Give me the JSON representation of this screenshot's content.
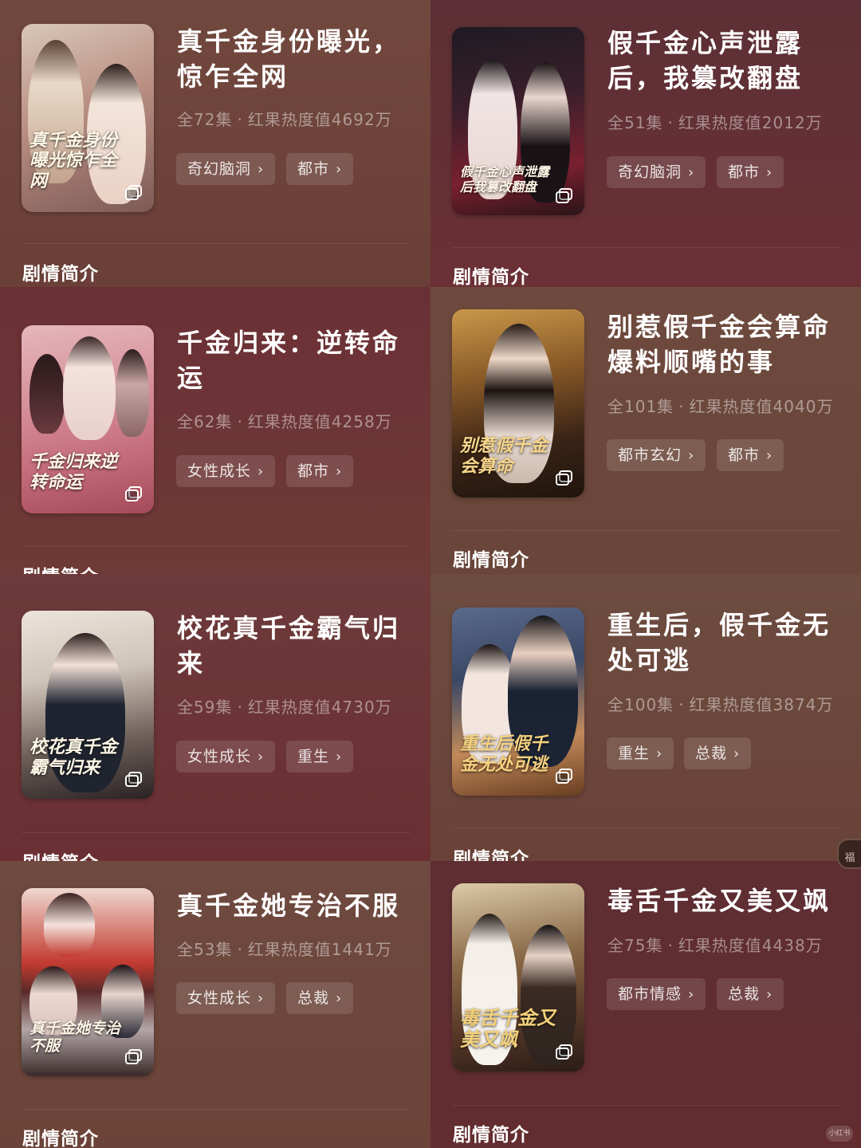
{
  "colors": {
    "title": "#ffffff",
    "meta": "#b39b93",
    "tag_bg": "rgba(255,255,255,0.12)",
    "section": "#ffffff"
  },
  "section_label": "剧情简介",
  "dramas": [
    {
      "id": "d1",
      "title": "真千金身份曝光，惊乍全网",
      "episodes": "全72集",
      "heat": "红果热度值4692万",
      "tags": [
        "奇幻脑洞",
        "都市"
      ],
      "cover_text": "真千金身份曝光惊乍全网"
    },
    {
      "id": "d2",
      "title": "假千金心声泄露后，我篡改翻盘",
      "episodes": "全51集",
      "heat": "红果热度值2012万",
      "tags": [
        "奇幻脑洞",
        "都市"
      ],
      "cover_text": "假千金心声泄露后我篡改翻盘"
    },
    {
      "id": "d3",
      "title": "千金归来：逆转命运",
      "episodes": "全62集",
      "heat": "红果热度值4258万",
      "tags": [
        "女性成长",
        "都市"
      ],
      "cover_text": "千金归来逆转命运"
    },
    {
      "id": "d4",
      "title": "别惹假千金会算命爆料顺嘴的事",
      "episodes": "全101集",
      "heat": "红果热度值4040万",
      "tags": [
        "都市玄幻",
        "都市"
      ],
      "cover_text": "别惹假千金会算命"
    },
    {
      "id": "d5",
      "title": "校花真千金霸气归来",
      "episodes": "全59集",
      "heat": "红果热度值4730万",
      "tags": [
        "女性成长",
        "重生"
      ],
      "cover_text": "校花真千金霸气归来"
    },
    {
      "id": "d6",
      "title": "重生后，假千金无处可逃",
      "episodes": "全100集",
      "heat": "红果热度值3874万",
      "tags": [
        "重生",
        "总裁"
      ],
      "cover_text": "重生后假千金无处可逃"
    },
    {
      "id": "d7",
      "title": "真千金她专治不服",
      "episodes": "全53集",
      "heat": "红果热度值1441万",
      "tags": [
        "女性成长",
        "总裁"
      ],
      "cover_text": "真千金她专治不服"
    },
    {
      "id": "d8",
      "title": "毒舌千金又美又飒",
      "episodes": "全75集",
      "heat": "红果热度值4438万",
      "tags": [
        "都市情感",
        "总裁"
      ],
      "cover_text": "毒舌千金又美又飒"
    }
  ],
  "floating_tab_label": "福",
  "watermark_label": "小红书"
}
